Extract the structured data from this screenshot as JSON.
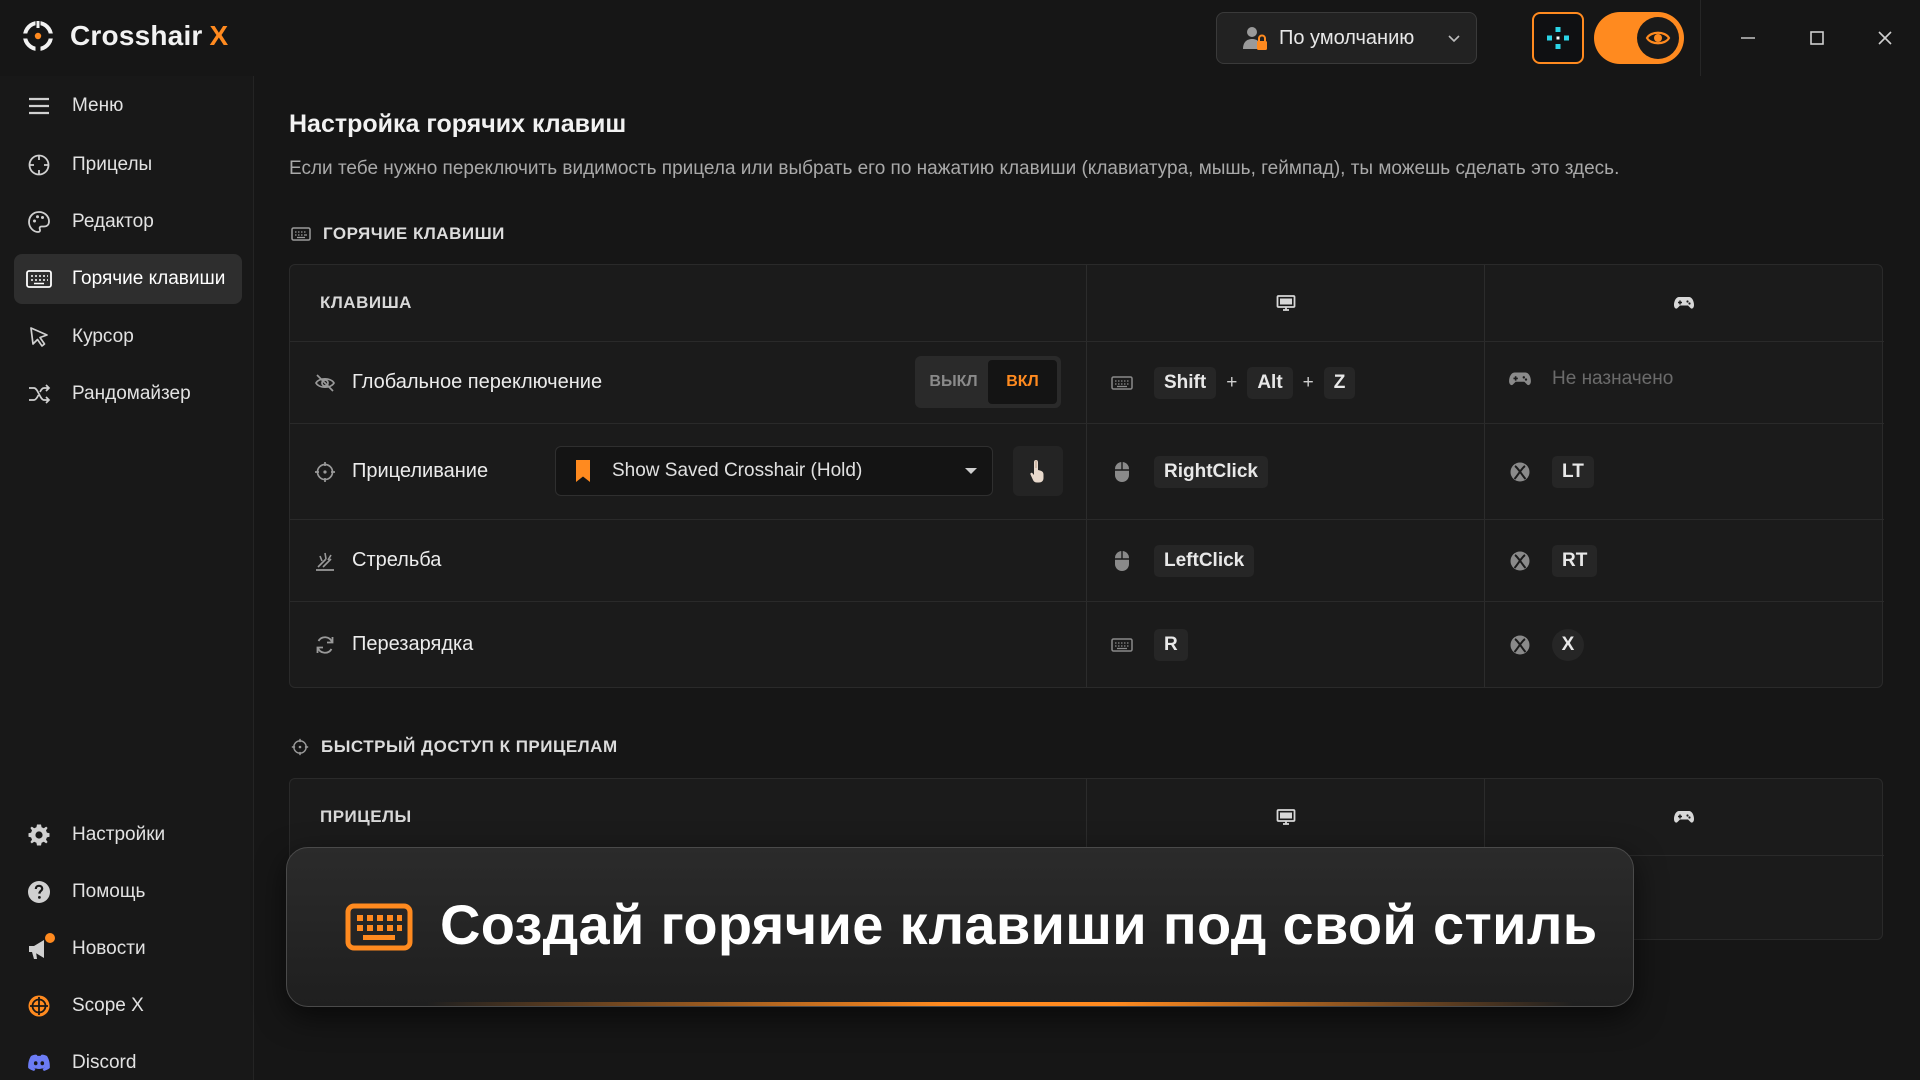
{
  "app": {
    "name": "Crosshair",
    "name_suffix": "X",
    "accent_color": "#ff8a1f"
  },
  "topbar": {
    "profile_label": "По умолчанию",
    "window_controls": [
      "minimize-icon",
      "maximize-icon",
      "close-icon"
    ]
  },
  "sidebar": {
    "items": [
      {
        "label": "Меню",
        "icon": "hamburger-icon"
      },
      {
        "label": "Прицелы",
        "icon": "crosshair-icon"
      },
      {
        "label": "Редактор",
        "icon": "palette-icon"
      },
      {
        "label": "Горячие клавиши",
        "icon": "keyboard-icon",
        "active": true
      },
      {
        "label": "Курсор",
        "icon": "cursor-icon"
      },
      {
        "label": "Рандомайзер",
        "icon": "shuffle-icon"
      }
    ],
    "bottom_items": [
      {
        "label": "Настройки",
        "icon": "gear-icon"
      },
      {
        "label": "Помощь",
        "icon": "help-icon"
      },
      {
        "label": "Новости",
        "icon": "megaphone-icon"
      },
      {
        "label": "Scope X",
        "icon": "scope-icon"
      },
      {
        "label": "Discord",
        "icon": "discord-icon"
      }
    ]
  },
  "main": {
    "title": "Настройка горячих клавиш",
    "description": "Если тебе нужно переключить видимость прицела или выбрать его по нажатию клавиши (клавиатура, мышь, геймпад), ты можешь сделать это здесь.",
    "hotkeys_section": {
      "heading": "ГОРЯЧИЕ КЛАВИШИ",
      "col_key": "КЛАВИША",
      "rows": [
        {
          "name": "Глобальное переключение",
          "icon": "eye-off-icon",
          "toggle_off": "ВЫКЛ",
          "toggle_on": "ВКЛ",
          "pc_device": "keyboard-icon",
          "pc_keys": [
            "Shift",
            "Alt",
            "Z"
          ],
          "pc_separator": "+",
          "pad_device": "gamepad-icon",
          "pad_unassigned": "Не назначено"
        },
        {
          "name": "Прицеливание",
          "icon": "crosshair-icon",
          "dropdown_value": "Show Saved Crosshair (Hold)",
          "pc_device": "mouse-icon",
          "pc_key": "RightClick",
          "pad_device": "xbox-icon",
          "pad_key": "LT"
        },
        {
          "name": "Стрельба",
          "icon": "shoot-icon",
          "pc_device": "mouse-icon",
          "pc_key": "LeftClick",
          "pad_device": "xbox-icon",
          "pad_key": "RT"
        },
        {
          "name": "Перезарядка",
          "icon": "reload-icon",
          "pc_device": "keyboard-icon",
          "pc_key": "R",
          "pad_device": "xbox-icon",
          "pad_key": "X"
        }
      ]
    },
    "quick_section": {
      "heading": "БЫСТРЫЙ ДОСТУП К ПРИЦЕЛАМ",
      "col_key": "ПРИЦЕЛЫ"
    }
  },
  "banner": {
    "text": "Создай горячие клавиши под свой стиль",
    "icon": "keyboard-icon"
  }
}
